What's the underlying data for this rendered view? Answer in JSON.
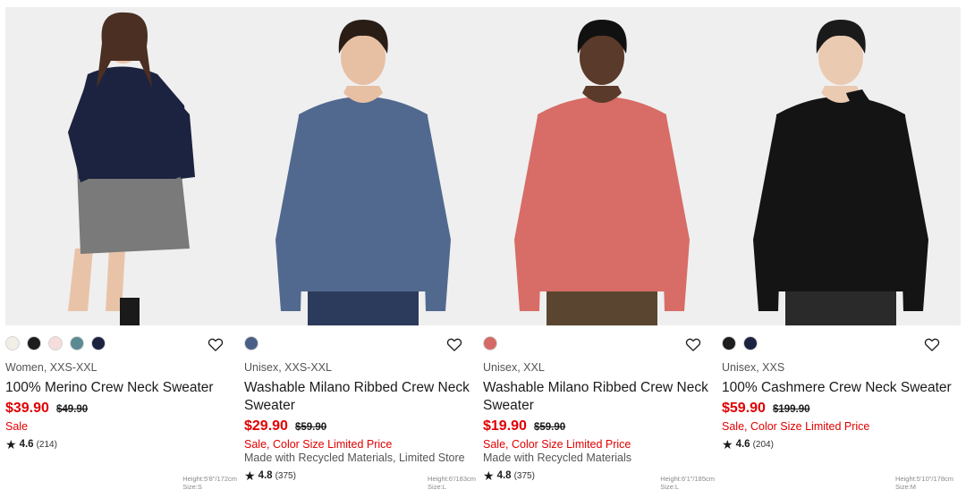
{
  "products": [
    {
      "model_info": [
        "Height:5'8\"/172cm",
        "Size:S"
      ],
      "colors": [
        "#f1efe6",
        "#1d1d1d",
        "#f7dcdc",
        "#5b8a93",
        "#1c2340"
      ],
      "category": "Women, XXS-XXL",
      "name": "100% Merino Crew Neck Sweater",
      "price": "$39.90",
      "original_price": "$49.90",
      "flags": "Sale",
      "note": "",
      "rating": "4.6",
      "reviews": "(214)",
      "sweater_color": "#1c2340",
      "skin": "#e9c3a8",
      "hair": "#4a2f22"
    },
    {
      "model_info": [
        "Height:6'/183cm",
        "Size:L"
      ],
      "colors": [
        "#4a5f86"
      ],
      "category": "Unisex, XXS-XXL",
      "name": "Washable Milano Ribbed Crew Neck Sweater",
      "price": "$29.90",
      "original_price": "$59.90",
      "flags": "Sale, Color Size Limited Price",
      "note": "Made with Recycled Materials, Limited Store",
      "rating": "4.8",
      "reviews": "(375)",
      "sweater_color": "#52698f",
      "skin": "#e7c0a3",
      "hair": "#2a1d16"
    },
    {
      "model_info": [
        "Height:6'1\"/185cm",
        "Size:L"
      ],
      "colors": [
        "#d46a66"
      ],
      "category": "Unisex, XXL",
      "name": "Washable Milano Ribbed Crew Neck Sweater",
      "price": "$19.90",
      "original_price": "$59.90",
      "flags": "Sale, Color Size Limited Price",
      "note": "Made with Recycled Materials",
      "rating": "4.8",
      "reviews": "(375)",
      "sweater_color": "#d76d66",
      "skin": "#5a3a2a",
      "hair": "#111111"
    },
    {
      "model_info": [
        "Height:5'10\"/178cm",
        "Size:M"
      ],
      "colors": [
        "#1d1d1d",
        "#1c2340"
      ],
      "category": "Unisex, XXS",
      "name": "100% Cashmere Crew Neck Sweater",
      "price": "$59.90",
      "original_price": "$199.90",
      "flags": "Sale, Color Size Limited Price",
      "note": "",
      "rating": "4.6",
      "reviews": "(204)",
      "sweater_color": "#141414",
      "skin": "#ebcab2",
      "hair": "#1a1a1a"
    }
  ]
}
